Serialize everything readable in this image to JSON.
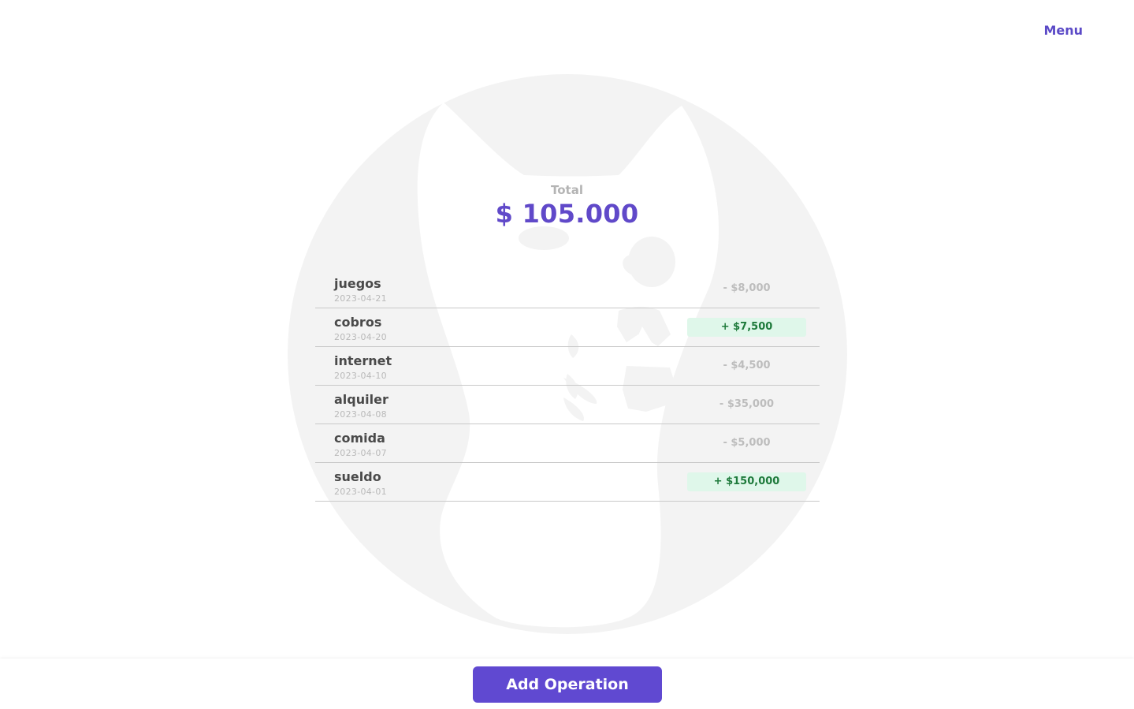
{
  "header": {
    "menu_label": "Menu"
  },
  "summary": {
    "label": "Total",
    "value": "$ 105.000"
  },
  "operations": [
    {
      "name": "juegos",
      "date": "2023-04-21",
      "amount": "- $8,000",
      "kind": "expense"
    },
    {
      "name": "cobros",
      "date": "2023-04-20",
      "amount": "+ $7,500",
      "kind": "income"
    },
    {
      "name": "internet",
      "date": "2023-04-10",
      "amount": "- $4,500",
      "kind": "expense"
    },
    {
      "name": "alquiler",
      "date": "2023-04-08",
      "amount": "- $35,000",
      "kind": "expense"
    },
    {
      "name": "comida",
      "date": "2023-04-07",
      "amount": "- $5,000",
      "kind": "expense"
    },
    {
      "name": "sueldo",
      "date": "2023-04-01",
      "amount": "+ $150,000",
      "kind": "income"
    }
  ],
  "footer": {
    "add_label": "Add Operation"
  },
  "colors": {
    "accent": "#6049d1",
    "income_bg": "#dff7ea",
    "income_text": "#1e7a3b",
    "expense_text": "#bdbdbd",
    "watermark": "#f3f3f3"
  },
  "icons": {
    "watermark": "dog-logo-icon"
  }
}
